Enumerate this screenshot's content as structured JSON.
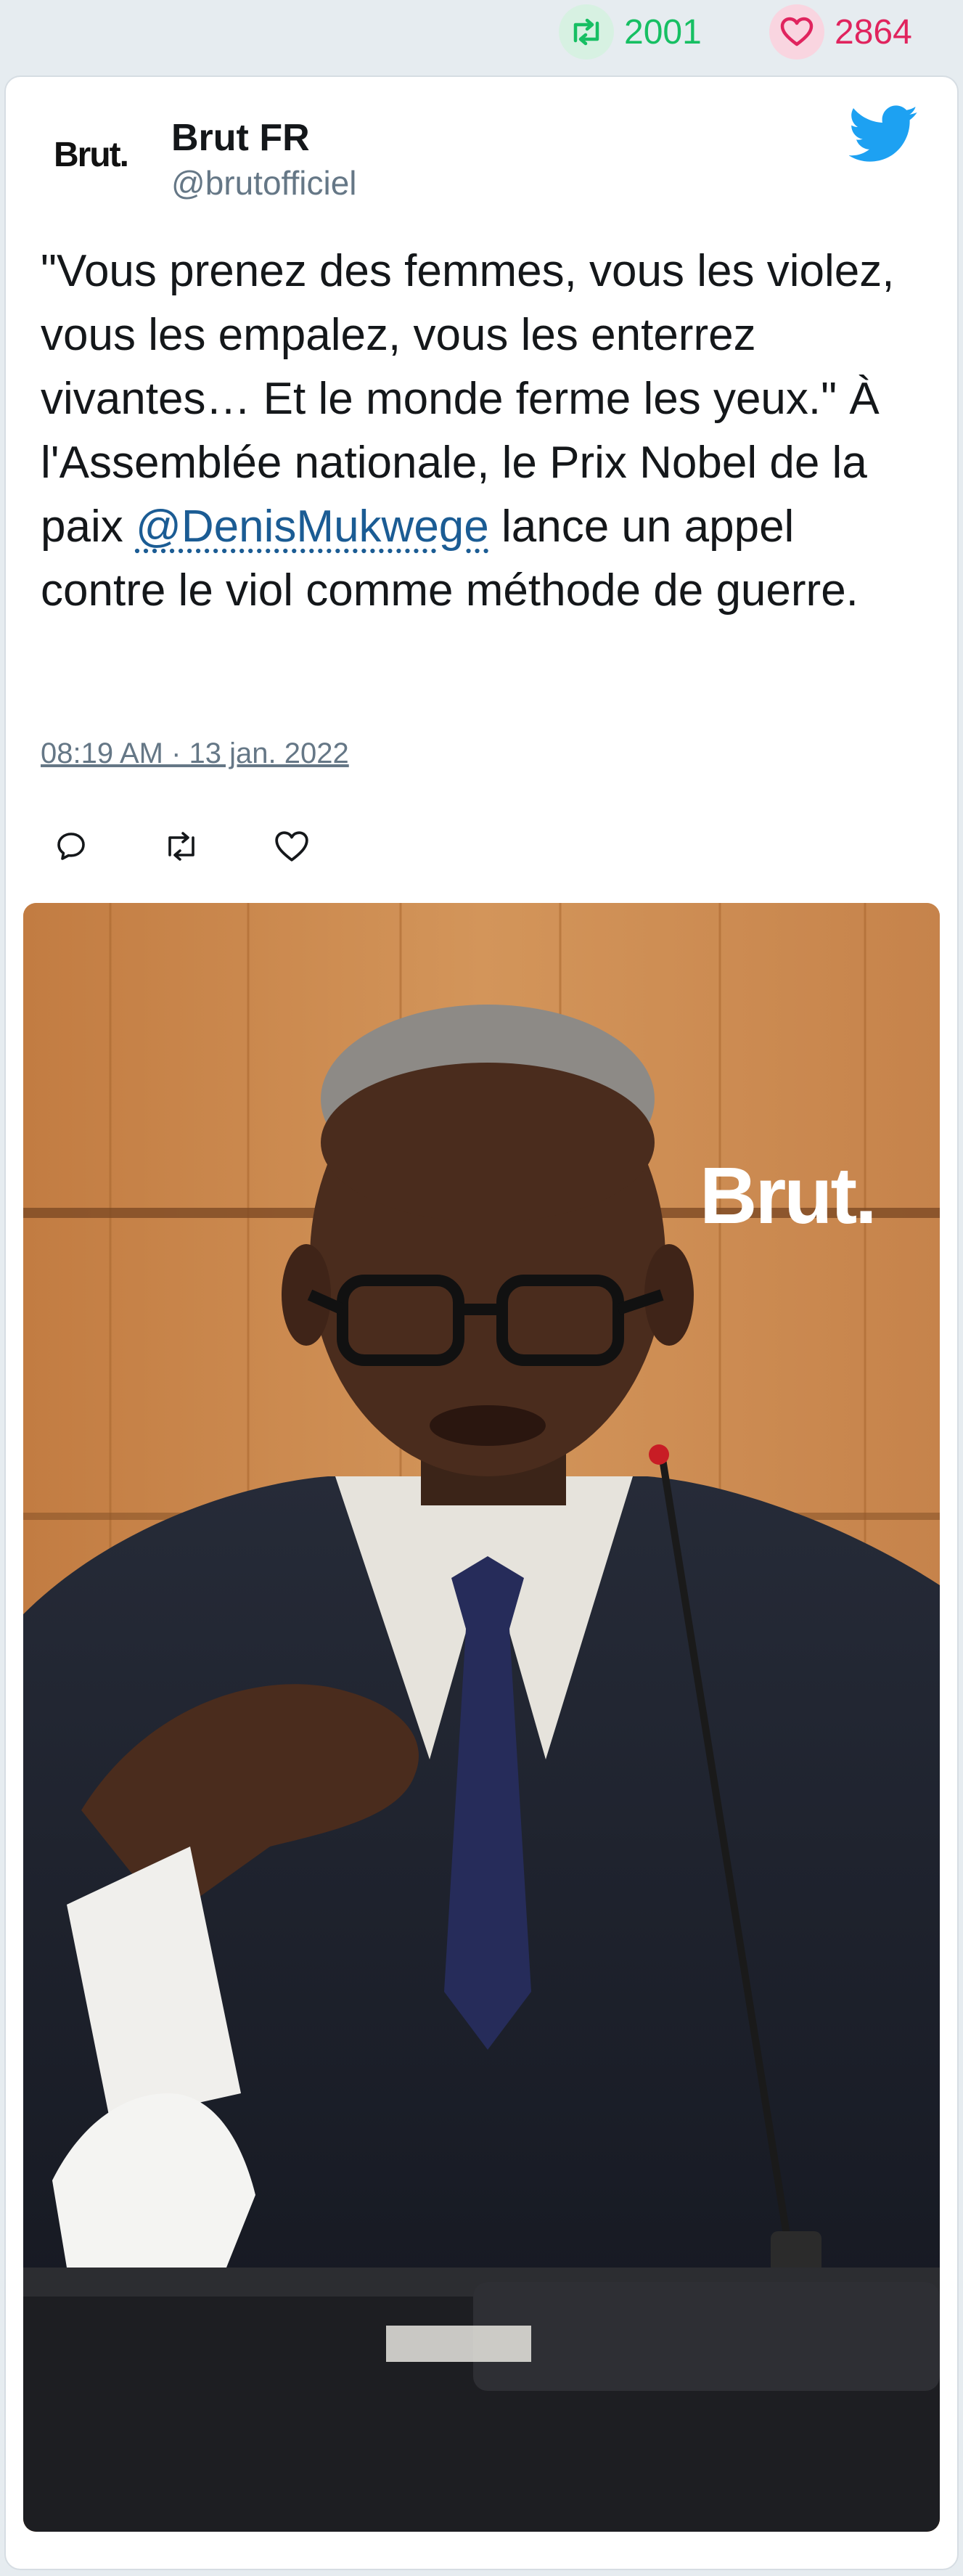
{
  "stats": {
    "retweets": "2001",
    "likes": "2864",
    "retweet_icon": "retweet-icon",
    "like_icon": "heart-icon",
    "retweet_color": "#17bf63",
    "like_color": "#e0245e"
  },
  "author": {
    "logo_text": "Brut.",
    "name": "Brut FR",
    "handle": "@brutofficiel"
  },
  "tweet": {
    "text_before": "\"Vous prenez des femmes, vous les violez, vous les empalez, vous les enterrez vivantes… Et le monde ferme les yeux.\" À l'Assemblée nationale, le Prix Nobel de la paix ",
    "mention": "@DenisMukwege",
    "text_after": " lance un appel contre le viol comme méthode de guerre.",
    "timestamp": "08:19 AM · 13 jan. 2022"
  },
  "actions": {
    "reply_icon": "reply-icon",
    "retweet_icon": "retweet-icon",
    "like_icon": "heart-icon"
  },
  "media": {
    "watermark": "Brut."
  },
  "colors": {
    "twitter_blue": "#1da1f2",
    "link": "#1b5c94",
    "muted": "#657786"
  }
}
